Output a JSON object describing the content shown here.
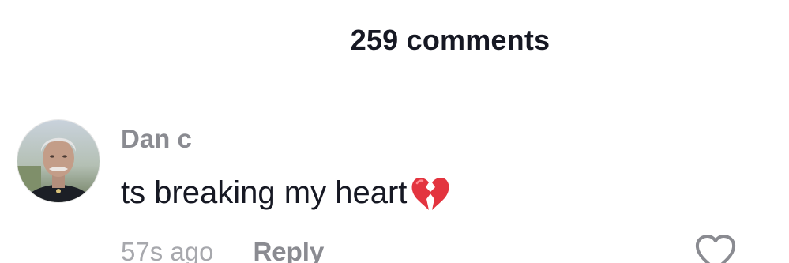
{
  "header": {
    "comment_count_label": "259 comments"
  },
  "comment": {
    "username": "Dan c",
    "text": "ts breaking my heart",
    "emoji_icon": "broken-heart-icon",
    "timestamp": "57s ago",
    "reply_label": "Reply",
    "like_icon": "heart-outline-icon"
  },
  "colors": {
    "primary_text": "#161823",
    "secondary_text": "#8a8b91",
    "emoji_red": "#e3343f"
  }
}
